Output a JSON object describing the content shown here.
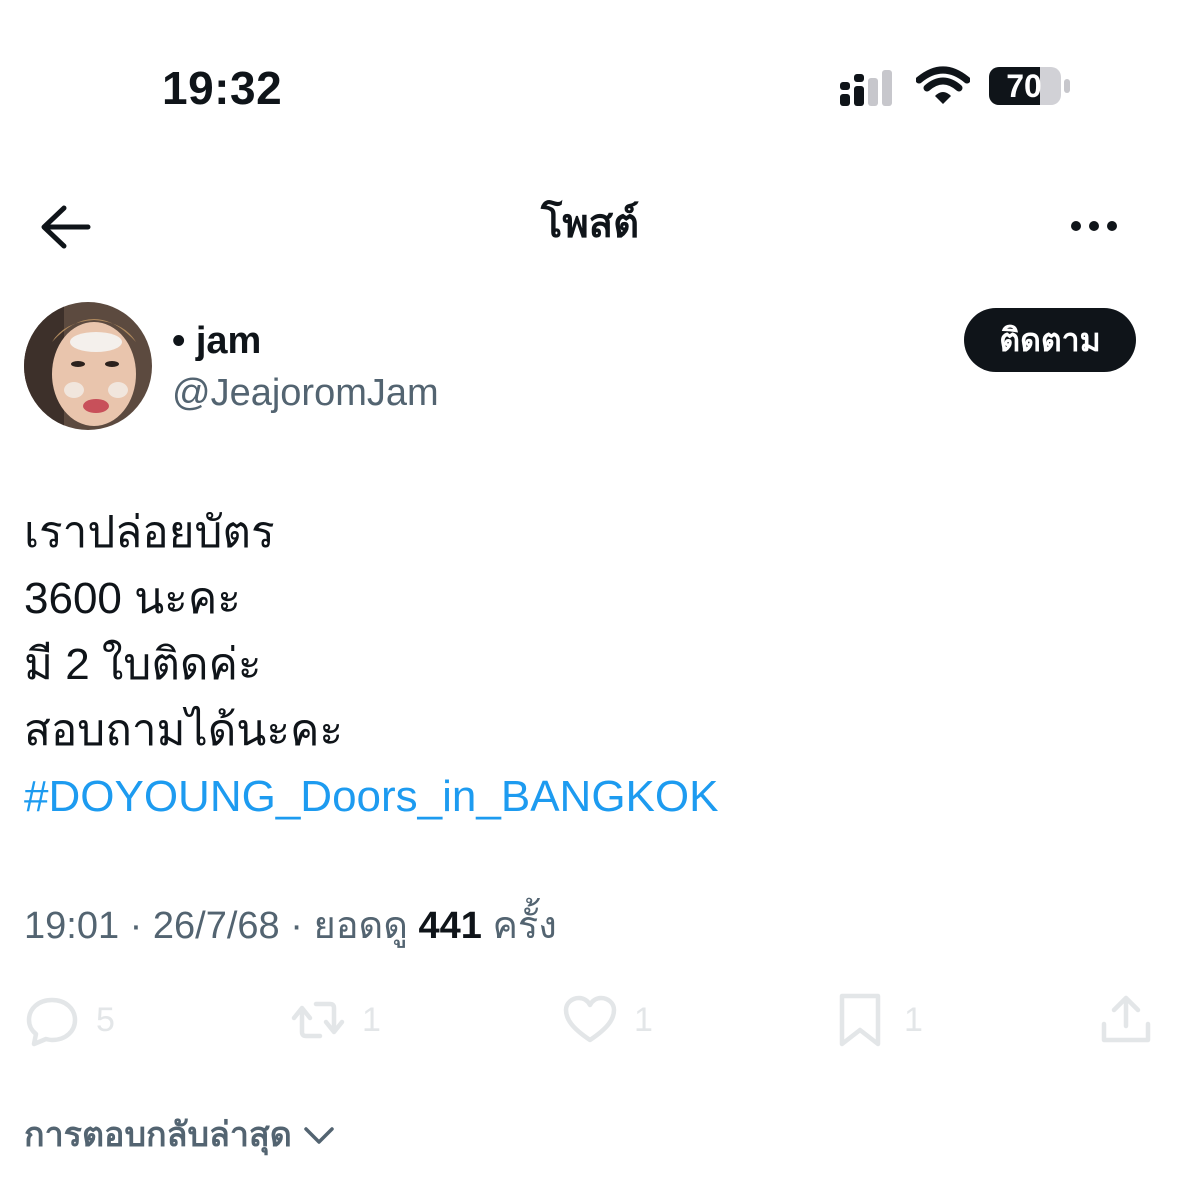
{
  "status_bar": {
    "time": "19:32",
    "battery_level": "70",
    "icons": [
      "cellular-signal-icon",
      "wifi-icon",
      "battery-icon"
    ]
  },
  "header": {
    "title": "โพสต์",
    "back_icon": "back-arrow-icon",
    "more_icon": "more-options-icon"
  },
  "author": {
    "display_name": "• jam",
    "handle": "@JeajoromJam",
    "follow_label": "ติดตาม"
  },
  "tweet": {
    "lines": [
      "เราปล่อยบัตร",
      "3600 นะคะ",
      "มี 2 ใบติดค่ะ",
      "สอบถามได้นะคะ"
    ],
    "hashtag": "#DOYOUNG_Doors_in_BANGKOK"
  },
  "meta": {
    "time": "19:01",
    "date": "26/7/68",
    "views_prefix": "ยอดดู",
    "views_count": "441",
    "views_suffix": "ครั้ง"
  },
  "actions": {
    "reply_count": "5",
    "retweet_count": "1",
    "like_count": "1",
    "bookmark_count": "1"
  },
  "replies": {
    "sort_label": "การตอบกลับล่าสุด"
  },
  "colors": {
    "text": "#0f1419",
    "secondary": "#536471",
    "link": "#1d9bf0",
    "faded": "#e3e6e8"
  }
}
